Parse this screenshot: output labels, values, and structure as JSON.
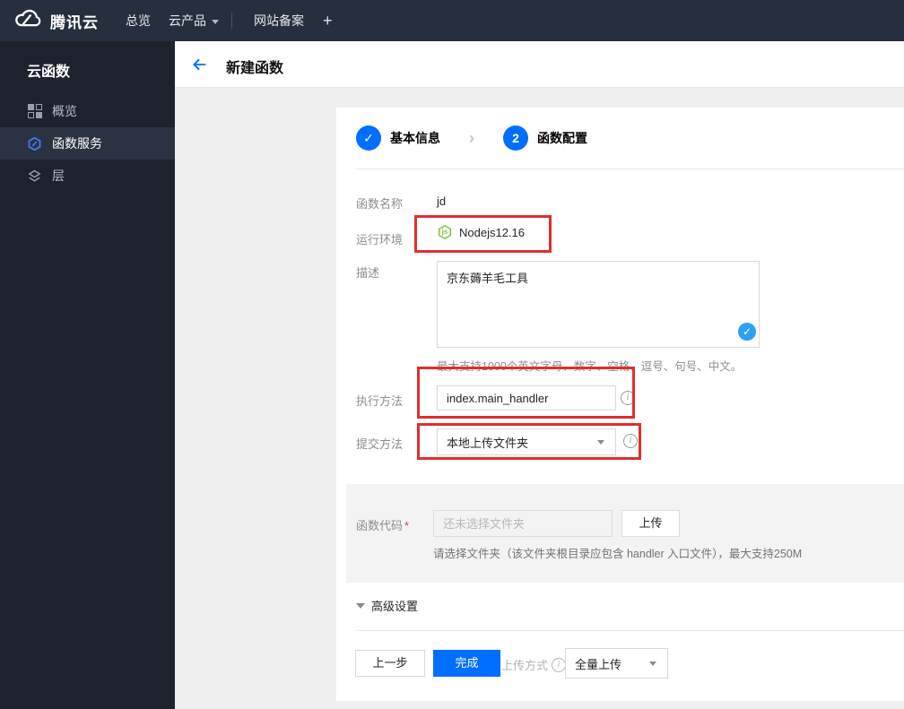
{
  "navbar": {
    "logo_text": "腾讯云",
    "overview": "总览",
    "products": "云产品",
    "icp": "网站备案",
    "plus": "+"
  },
  "sidebar": {
    "title": "云函数",
    "items": [
      {
        "label": "概览"
      },
      {
        "label": "函数服务"
      },
      {
        "label": "层"
      }
    ]
  },
  "header": {
    "title": "新建函数"
  },
  "steps": [
    {
      "num": "✓",
      "label": "基本信息"
    },
    {
      "num": "2",
      "label": "函数配置"
    }
  ],
  "form": {
    "name": {
      "label": "函数名称",
      "value": "jd"
    },
    "runtime": {
      "label": "运行环境",
      "value": "Nodejs12.16",
      "icon_text": "js"
    },
    "description": {
      "label": "描述",
      "value": "京东薅羊毛工具",
      "hint": "最大支持1000个英文字母、数字、空格、逗号、句号、中文。"
    },
    "handler": {
      "label": "执行方法",
      "value": "index.main_handler"
    },
    "submit": {
      "label": "提交方法",
      "value": "本地上传文件夹"
    },
    "code": {
      "label": "函数代码",
      "required": "*",
      "placeholder": "还未选择文件夹",
      "upload": "上传",
      "hint": "请选择文件夹（该文件夹根目录应包含 handler 入口文件），最大支持250M"
    },
    "advanced": {
      "label": "高级设置"
    }
  },
  "footer": {
    "prev": "上一步",
    "finish": "完成",
    "upload_mode_label": "上传方式",
    "upload_mode_value": "全量上传"
  },
  "icons": {
    "check": "✓",
    "info": "i",
    "step_chevron": "›"
  },
  "colors": {
    "accent": "#006eff",
    "annotation": "#e02e2e",
    "node_green": "#84be41",
    "check_blue": "#2f9ff5"
  }
}
